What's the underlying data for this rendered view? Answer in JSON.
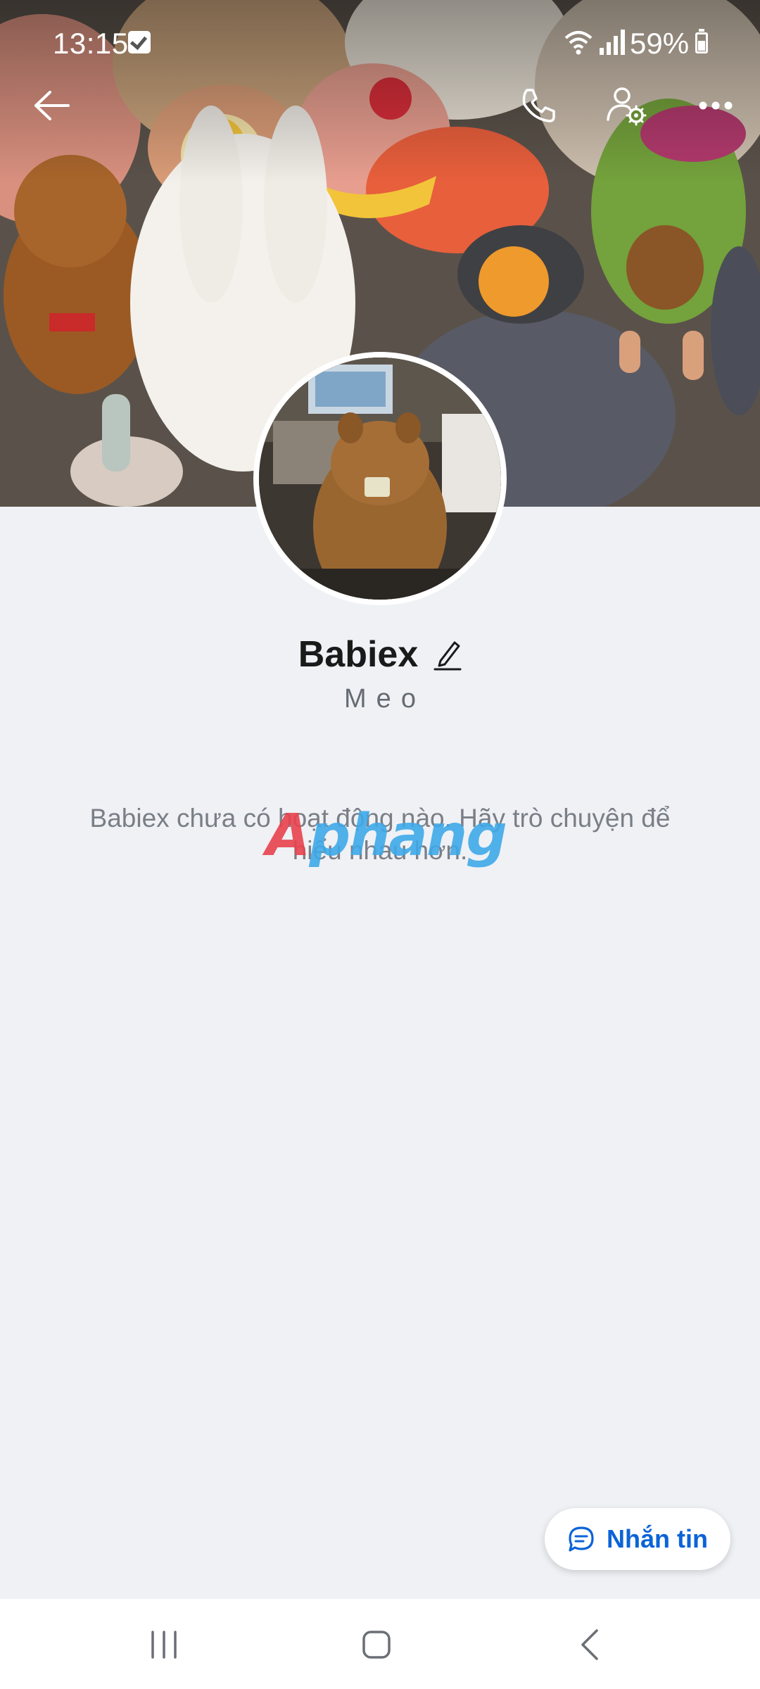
{
  "status_bar": {
    "time": "13:15",
    "battery_percent": "59%",
    "icons": [
      "check-notification-icon",
      "wifi-icon",
      "signal-icon",
      "battery-icon"
    ]
  },
  "top_nav": {
    "icons": [
      "back-arrow-icon",
      "phone-icon",
      "user-settings-icon",
      "more-icon"
    ]
  },
  "profile": {
    "name": "Babiex",
    "bio": "Meo",
    "empty_message": "Babiex chưa có hoạt động nào. Hãy trò chuyện để hiểu nhau hơn."
  },
  "watermark": {
    "part1": "A",
    "part2": "phang"
  },
  "message_button": {
    "label": "Nhắn tin",
    "icon": "chat-bubble-icon"
  },
  "system_nav": {
    "icons": [
      "recents-icon",
      "home-icon",
      "back-icon"
    ]
  },
  "colors": {
    "accent": "#0b63d8",
    "background": "#eff1f5"
  }
}
